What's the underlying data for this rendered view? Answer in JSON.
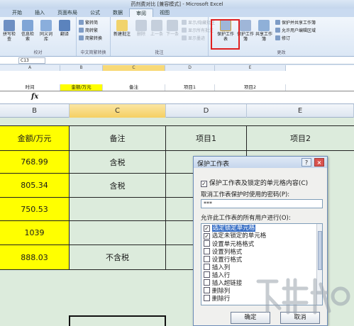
{
  "window": {
    "title": "药剂费对比 [兼容模式] - Microsoft Excel"
  },
  "ribbon": {
    "tabs": [
      "开始",
      "插入",
      "页面布局",
      "公式",
      "数据",
      "审阅",
      "视图"
    ],
    "active_tab": "审阅",
    "proofing": {
      "label": "校对",
      "buttons": [
        "拼写检查",
        "信息检索",
        "同义词库",
        "翻译"
      ]
    },
    "chinese": {
      "label": "中文简繁转换",
      "buttons": [
        "繁转简",
        "简转繁",
        "简繁转换"
      ]
    },
    "comments": {
      "label": "批注",
      "new_comment": "新建批注",
      "delete": "删除",
      "prev": "上一条",
      "next": "下一条",
      "show_hide": "显示/隐藏批注",
      "show_all": "显示所有批注",
      "show_ink": "显示墨迹"
    },
    "changes": {
      "label": "更改",
      "protect_sheet": "保护工作表",
      "protect_workbook": "保护工作簿",
      "share_workbook": "共享工作簿",
      "protect_share": "保护并共享工作簿",
      "allow_edit": "允许用户编辑区域",
      "track": "修订"
    }
  },
  "name_box": "C13",
  "mini_grid": {
    "columns": [
      "A",
      "B",
      "C",
      "D",
      "E"
    ],
    "cells": [
      "时间",
      "金额/万元",
      "备注",
      "项目1",
      "项目2"
    ]
  },
  "formula_bar": {
    "fx": "fx"
  },
  "column_headers": [
    "B",
    "C",
    "D",
    "E"
  ],
  "grid": {
    "header": [
      "金额/万元",
      "备注",
      "项目1",
      "项目2"
    ],
    "rows": [
      {
        "amount": "768.99",
        "note": "含税"
      },
      {
        "amount": "805.34",
        "note": "含税"
      },
      {
        "amount": "750.53",
        "note": ""
      },
      {
        "amount": "1039",
        "note": ""
      },
      {
        "amount": "888.03",
        "note": "不含税"
      }
    ]
  },
  "dialog": {
    "title": "保护工作表",
    "help": "?",
    "close": "×",
    "protect_option": "保护工作表及锁定的单元格内容(C)",
    "password_label": "取消工作表保护时使用的密码(P):",
    "password_value": "***",
    "allow_label": "允许此工作表的所有用户进行(O):",
    "options": [
      {
        "label": "选定锁定单元格",
        "checked": true
      },
      {
        "label": "选定未锁定的单元格",
        "checked": true
      },
      {
        "label": "设置单元格格式",
        "checked": false
      },
      {
        "label": "设置列格式",
        "checked": false
      },
      {
        "label": "设置行格式",
        "checked": false
      },
      {
        "label": "插入列",
        "checked": false
      },
      {
        "label": "插入行",
        "checked": false
      },
      {
        "label": "插入超链接",
        "checked": false
      },
      {
        "label": "删除列",
        "checked": false
      },
      {
        "label": "删除行",
        "checked": false
      }
    ],
    "ok": "确定",
    "cancel": "取消"
  },
  "colors": {
    "yellow": "#ffff00",
    "selection": "#3a70c6",
    "highlight_box": "#e02020",
    "grid_bg": "#dcebdc"
  }
}
